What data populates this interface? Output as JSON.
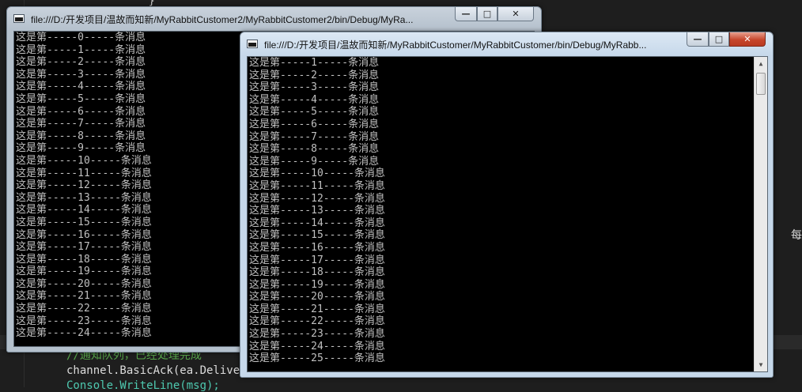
{
  "editor": {
    "top_line": "                        }",
    "comment_line": "//通知队列，已经处理完成",
    "code_line_1": "channel.BasicAck(ea.Deliver",
    "code_line_2": "Console.WriteLine(msg);",
    "right_fragment": "每一"
  },
  "window_back": {
    "title": "file:///D:/开发项目/温故而知新/MyRabbitCustomer2/MyRabbitCustomer2/bin/Debug/MyRa...",
    "minimize_label": "—",
    "maximize_label": "□",
    "close_label": "✕",
    "lines": [
      "这是第-----0-----条消息",
      "这是第-----1-----条消息",
      "这是第-----2-----条消息",
      "这是第-----3-----条消息",
      "这是第-----4-----条消息",
      "这是第-----5-----条消息",
      "这是第-----6-----条消息",
      "这是第-----7-----条消息",
      "这是第-----8-----条消息",
      "这是第-----9-----条消息",
      "这是第-----10-----条消息",
      "这是第-----11-----条消息",
      "这是第-----12-----条消息",
      "这是第-----13-----条消息",
      "这是第-----14-----条消息",
      "这是第-----15-----条消息",
      "这是第-----16-----条消息",
      "这是第-----17-----条消息",
      "这是第-----18-----条消息",
      "这是第-----19-----条消息",
      "这是第-----20-----条消息",
      "这是第-----21-----条消息",
      "这是第-----22-----条消息",
      "这是第-----23-----条消息",
      "这是第-----24-----条消息"
    ]
  },
  "window_front": {
    "title": "file:///D:/开发项目/温故而知新/MyRabbitCustomer/MyRabbitCustomer/bin/Debug/MyRabb...",
    "minimize_label": "—",
    "maximize_label": "□",
    "close_label": "✕",
    "scroll_up": "▲",
    "scroll_down": "▼",
    "lines": [
      "这是第-----1-----条消息",
      "这是第-----2-----条消息",
      "这是第-----3-----条消息",
      "这是第-----4-----条消息",
      "这是第-----5-----条消息",
      "这是第-----6-----条消息",
      "这是第-----7-----条消息",
      "这是第-----8-----条消息",
      "这是第-----9-----条消息",
      "这是第-----10-----条消息",
      "这是第-----11-----条消息",
      "这是第-----12-----条消息",
      "这是第-----13-----条消息",
      "这是第-----14-----条消息",
      "这是第-----15-----条消息",
      "这是第-----16-----条消息",
      "这是第-----17-----条消息",
      "这是第-----18-----条消息",
      "这是第-----19-----条消息",
      "这是第-----20-----条消息",
      "这是第-----21-----条消息",
      "这是第-----22-----条消息",
      "这是第-----23-----条消息",
      "这是第-----24-----条消息",
      "这是第-----25-----条消息"
    ]
  },
  "colors": {
    "console_bg": "#000000",
    "console_text": "#c0c0c0",
    "close_button": "#c7462c",
    "editor_bg": "#1e1e1e"
  },
  "icons": {
    "app_icon": "console-window-icon",
    "minimize": "minimize-icon",
    "maximize": "maximize-icon",
    "close": "close-icon",
    "scroll_up": "arrow-up-icon",
    "scroll_down": "arrow-down-icon"
  }
}
